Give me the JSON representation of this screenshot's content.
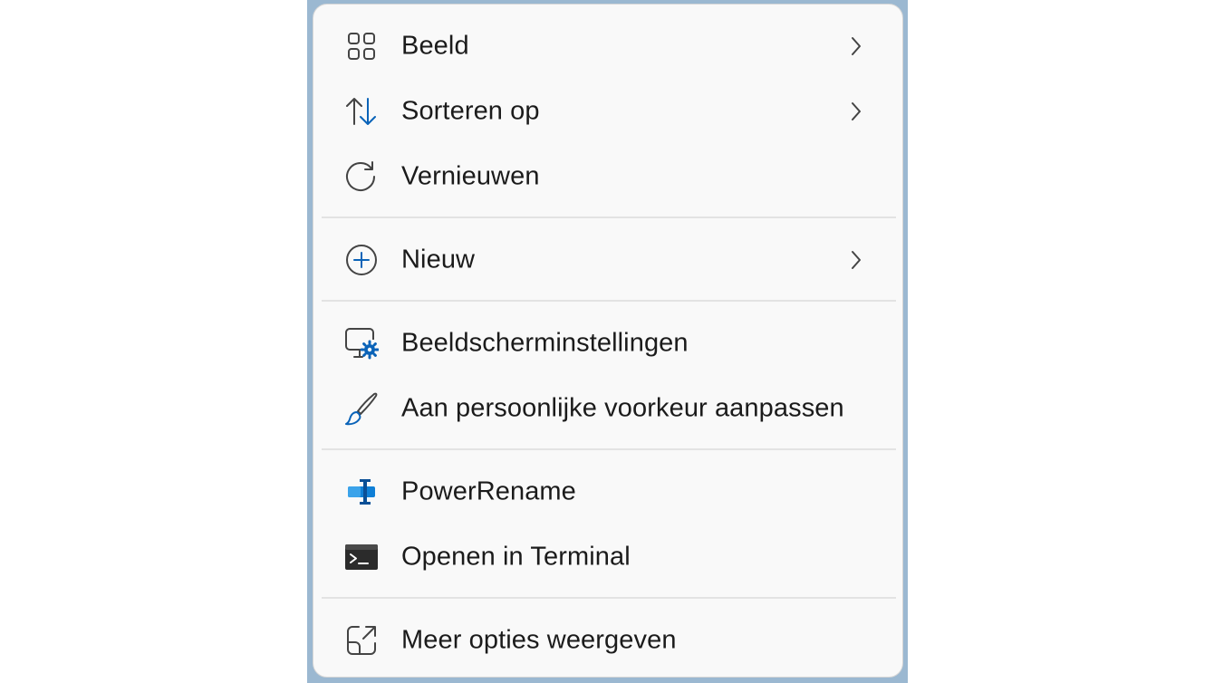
{
  "colors": {
    "accent": "#0a63b8",
    "text": "#1b1b1b",
    "icon_stroke": "#444444",
    "menu_background": "#f9f9f9",
    "separator": "#e3e3e3"
  },
  "menu": {
    "items": [
      {
        "label": "Beeld",
        "icon": "view-grid-icon",
        "has_submenu": true
      },
      {
        "label": "Sorteren op",
        "icon": "sort-arrows-icon",
        "has_submenu": true
      },
      {
        "label": "Vernieuwen",
        "icon": "refresh-icon",
        "has_submenu": false
      },
      {
        "label": "Nieuw",
        "icon": "add-circle-icon",
        "has_submenu": true
      },
      {
        "label": "Beeldscherminstellingen",
        "icon": "display-settings-icon",
        "has_submenu": false
      },
      {
        "label": "Aan persoonlijke voorkeur aanpassen",
        "icon": "paintbrush-icon",
        "has_submenu": false
      },
      {
        "label": "PowerRename",
        "icon": "powerrename-icon",
        "has_submenu": false
      },
      {
        "label": "Openen in Terminal",
        "icon": "terminal-icon",
        "has_submenu": false
      },
      {
        "label": "Meer opties weergeven",
        "icon": "open-external-icon",
        "has_submenu": false
      }
    ]
  }
}
